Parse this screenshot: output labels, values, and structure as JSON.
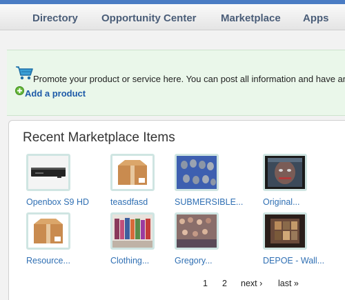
{
  "nav": {
    "items": [
      {
        "label": "Directory"
      },
      {
        "label": "Opportunity Center"
      },
      {
        "label": "Marketplace"
      },
      {
        "label": "Apps"
      }
    ]
  },
  "promo": {
    "text": "Promote your product or service here. You can post all information and have an",
    "add_label": "Add a product"
  },
  "panel": {
    "title": "Recent Marketplace Items",
    "items": [
      {
        "label": "Openbox S9 HD",
        "icon": "set-top-box"
      },
      {
        "label": "teasdfasd",
        "icon": "cardboard-box"
      },
      {
        "label": "SUBMERSIBLE...",
        "icon": "submersible-pumps"
      },
      {
        "label": "Original...",
        "icon": "painting"
      },
      {
        "label": "Resource...",
        "icon": "cardboard-box"
      },
      {
        "label": "Clothing...",
        "icon": "clothing-rack"
      },
      {
        "label": "Gregory...",
        "icon": "crowd-photo"
      },
      {
        "label": "DEPOE - Wall...",
        "icon": "wall-art"
      }
    ],
    "pagination": {
      "page1": "1",
      "page2": "2",
      "next": "next ›",
      "last": "last »"
    }
  }
}
